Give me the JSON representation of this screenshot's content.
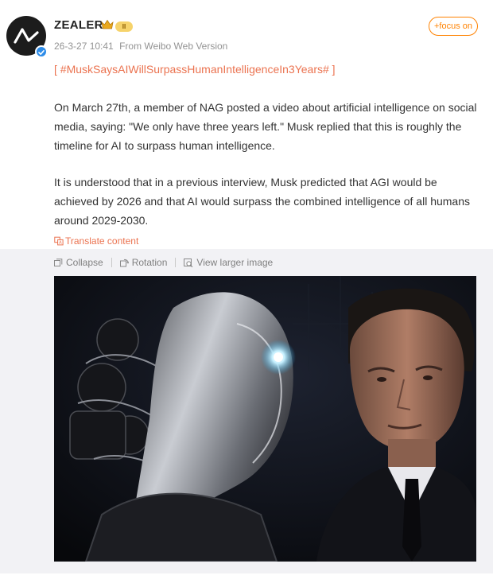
{
  "post": {
    "author": {
      "name": "ZEALER",
      "level": "II"
    },
    "timestamp": "26-3-27 10:41",
    "source": "From Weibo Web Version",
    "focus_label": "+focus on",
    "topic": {
      "open": "[",
      "tag": "#MuskSaysAIWillSurpassHumanIntelligenceIn3Years#",
      "close": "]"
    },
    "paragraphs": [
      "On March 27th, a member of NAG posted a video about artificial intelligence on social media, saying: \"We only have three years left.\" Musk replied that this is roughly the timeline for AI to surpass human intelligence.",
      "It is understood that in a previous interview, Musk predicted that AGI would be achieved by 2026 and that AI would surpass the combined intelligence of all humans around 2029-2030."
    ],
    "translate_label": "Translate content"
  },
  "media_toolbar": {
    "collapse_label": "Collapse",
    "rotation_label": "Rotation",
    "view_larger_label": "View larger image"
  },
  "colors": {
    "accent": "#ff8200",
    "topic": "#eb7350",
    "muted": "#939393",
    "panel": "#f2f2f5",
    "verified": "#2d8ce8"
  }
}
